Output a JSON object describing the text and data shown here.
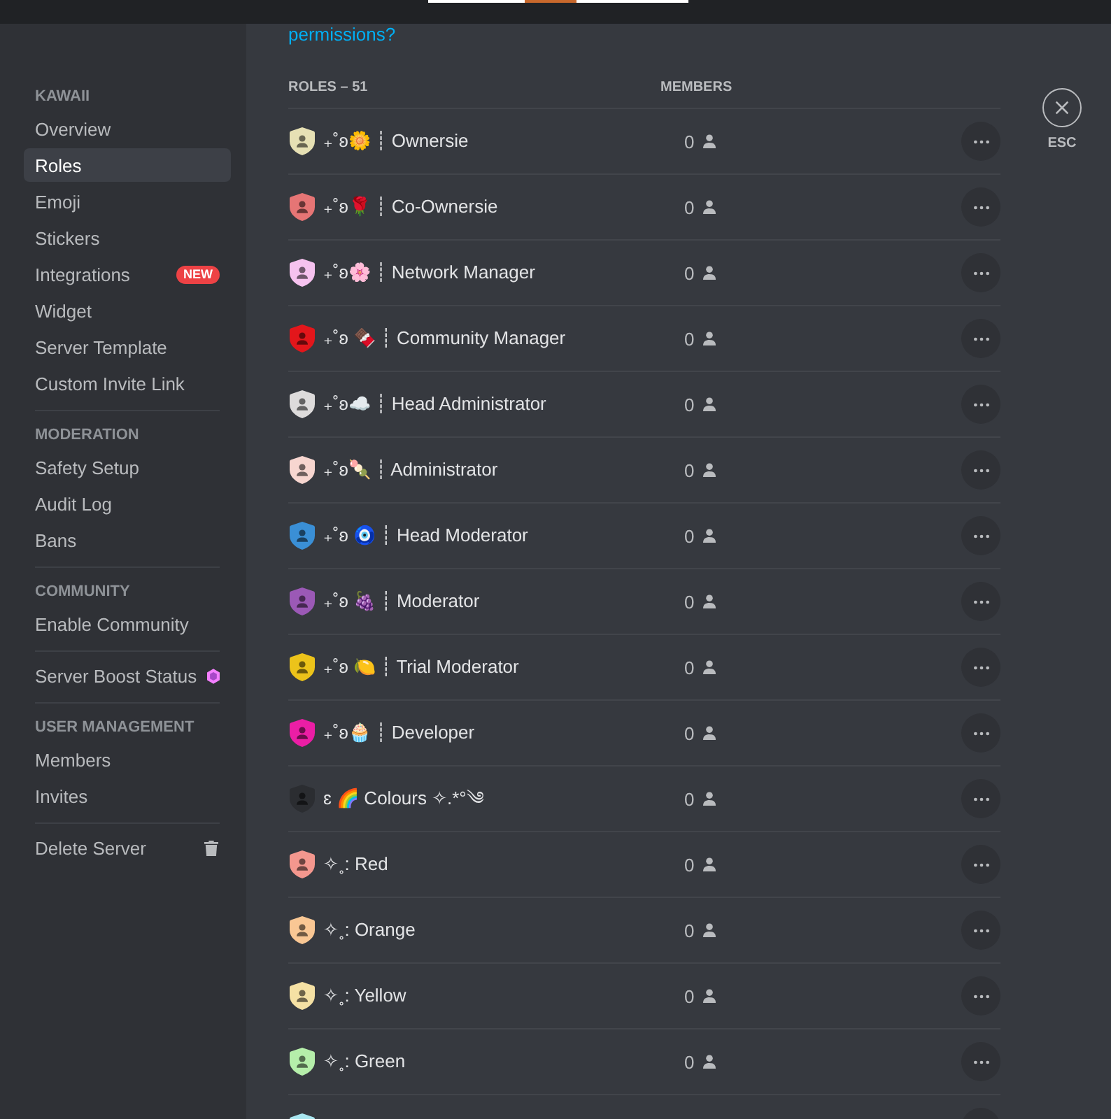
{
  "sidebar": {
    "sections": [
      {
        "header": "KAWAII",
        "items": [
          {
            "label": "Overview",
            "kind": "link",
            "selected": false
          },
          {
            "label": "Roles",
            "kind": "link",
            "selected": true
          },
          {
            "label": "Emoji",
            "kind": "link",
            "selected": false
          },
          {
            "label": "Stickers",
            "kind": "link",
            "selected": false
          },
          {
            "label": "Integrations",
            "kind": "badge",
            "badge": "NEW",
            "selected": false
          },
          {
            "label": "Widget",
            "kind": "link",
            "selected": false
          },
          {
            "label": "Server Template",
            "kind": "link",
            "selected": false
          },
          {
            "label": "Custom Invite Link",
            "kind": "link",
            "selected": false
          }
        ]
      },
      {
        "header": "MODERATION",
        "items": [
          {
            "label": "Safety Setup",
            "kind": "link",
            "selected": false
          },
          {
            "label": "Audit Log",
            "kind": "link",
            "selected": false
          },
          {
            "label": "Bans",
            "kind": "link",
            "selected": false
          }
        ]
      },
      {
        "header": "COMMUNITY",
        "items": [
          {
            "label": "Enable Community",
            "kind": "link",
            "selected": false
          }
        ]
      },
      {
        "items": [
          {
            "label": "Server Boost Status",
            "kind": "boost",
            "selected": false
          }
        ]
      },
      {
        "header": "USER MANAGEMENT",
        "items": [
          {
            "label": "Members",
            "kind": "link",
            "selected": false
          },
          {
            "label": "Invites",
            "kind": "link",
            "selected": false
          }
        ]
      },
      {
        "items": [
          {
            "label": "Delete Server",
            "kind": "delete",
            "selected": false
          }
        ]
      }
    ]
  },
  "help_link": "permissions?",
  "roles_table": {
    "columns": [
      "ROLES – 51",
      "MEMBERS"
    ],
    "rows": [
      {
        "name": "₊˚ʚ🌼 ┊ Ownersie",
        "color": "#e6e0b4",
        "members": "0"
      },
      {
        "name": "₊˚ʚ🌹 ┊ Co-Ownersie",
        "color": "#e67575",
        "members": "0"
      },
      {
        "name": "₊˚ʚ🌸 ┊ Network Manager",
        "color": "#f6c2ef",
        "members": "0"
      },
      {
        "name": "₊˚ʚ 🍫 ┊ Community Manager",
        "color": "#e3161b",
        "members": "0"
      },
      {
        "name": "₊˚ʚ☁️ ┊ Head Administrator",
        "color": "#dddbdb",
        "members": "0"
      },
      {
        "name": "₊˚ʚ🍡 ┊ Administrator",
        "color": "#f7d6d0",
        "members": "0"
      },
      {
        "name": "₊˚ʚ 🧿 ┊ Head Moderator",
        "color": "#3a8fd6",
        "members": "0"
      },
      {
        "name": "₊˚ʚ 🍇 ┊ Moderator",
        "color": "#9b59b6",
        "members": "0"
      },
      {
        "name": "₊˚ʚ 🍋 ┊ Trial Moderator",
        "color": "#ecc31a",
        "members": "0"
      },
      {
        "name": "₊˚ʚ🧁 ┊ Developer",
        "color": "#eb1ea5",
        "members": "0"
      },
      {
        "name": "ɛ 🌈 Colours ✧.*°༄",
        "color": "#2b2d31",
        "members": "0"
      },
      {
        "name": "✧˳: Red",
        "color": "#f4978e",
        "members": "0"
      },
      {
        "name": "✧˳: Orange",
        "color": "#f9c794",
        "members": "0"
      },
      {
        "name": "✧˳: Yellow",
        "color": "#f5e1a4",
        "members": "0"
      },
      {
        "name": "✧˳: Green",
        "color": "#b5eeaa",
        "members": "0"
      },
      {
        "color": "#a8e6f0"
      }
    ]
  },
  "close_button": {
    "label": "ESC"
  }
}
